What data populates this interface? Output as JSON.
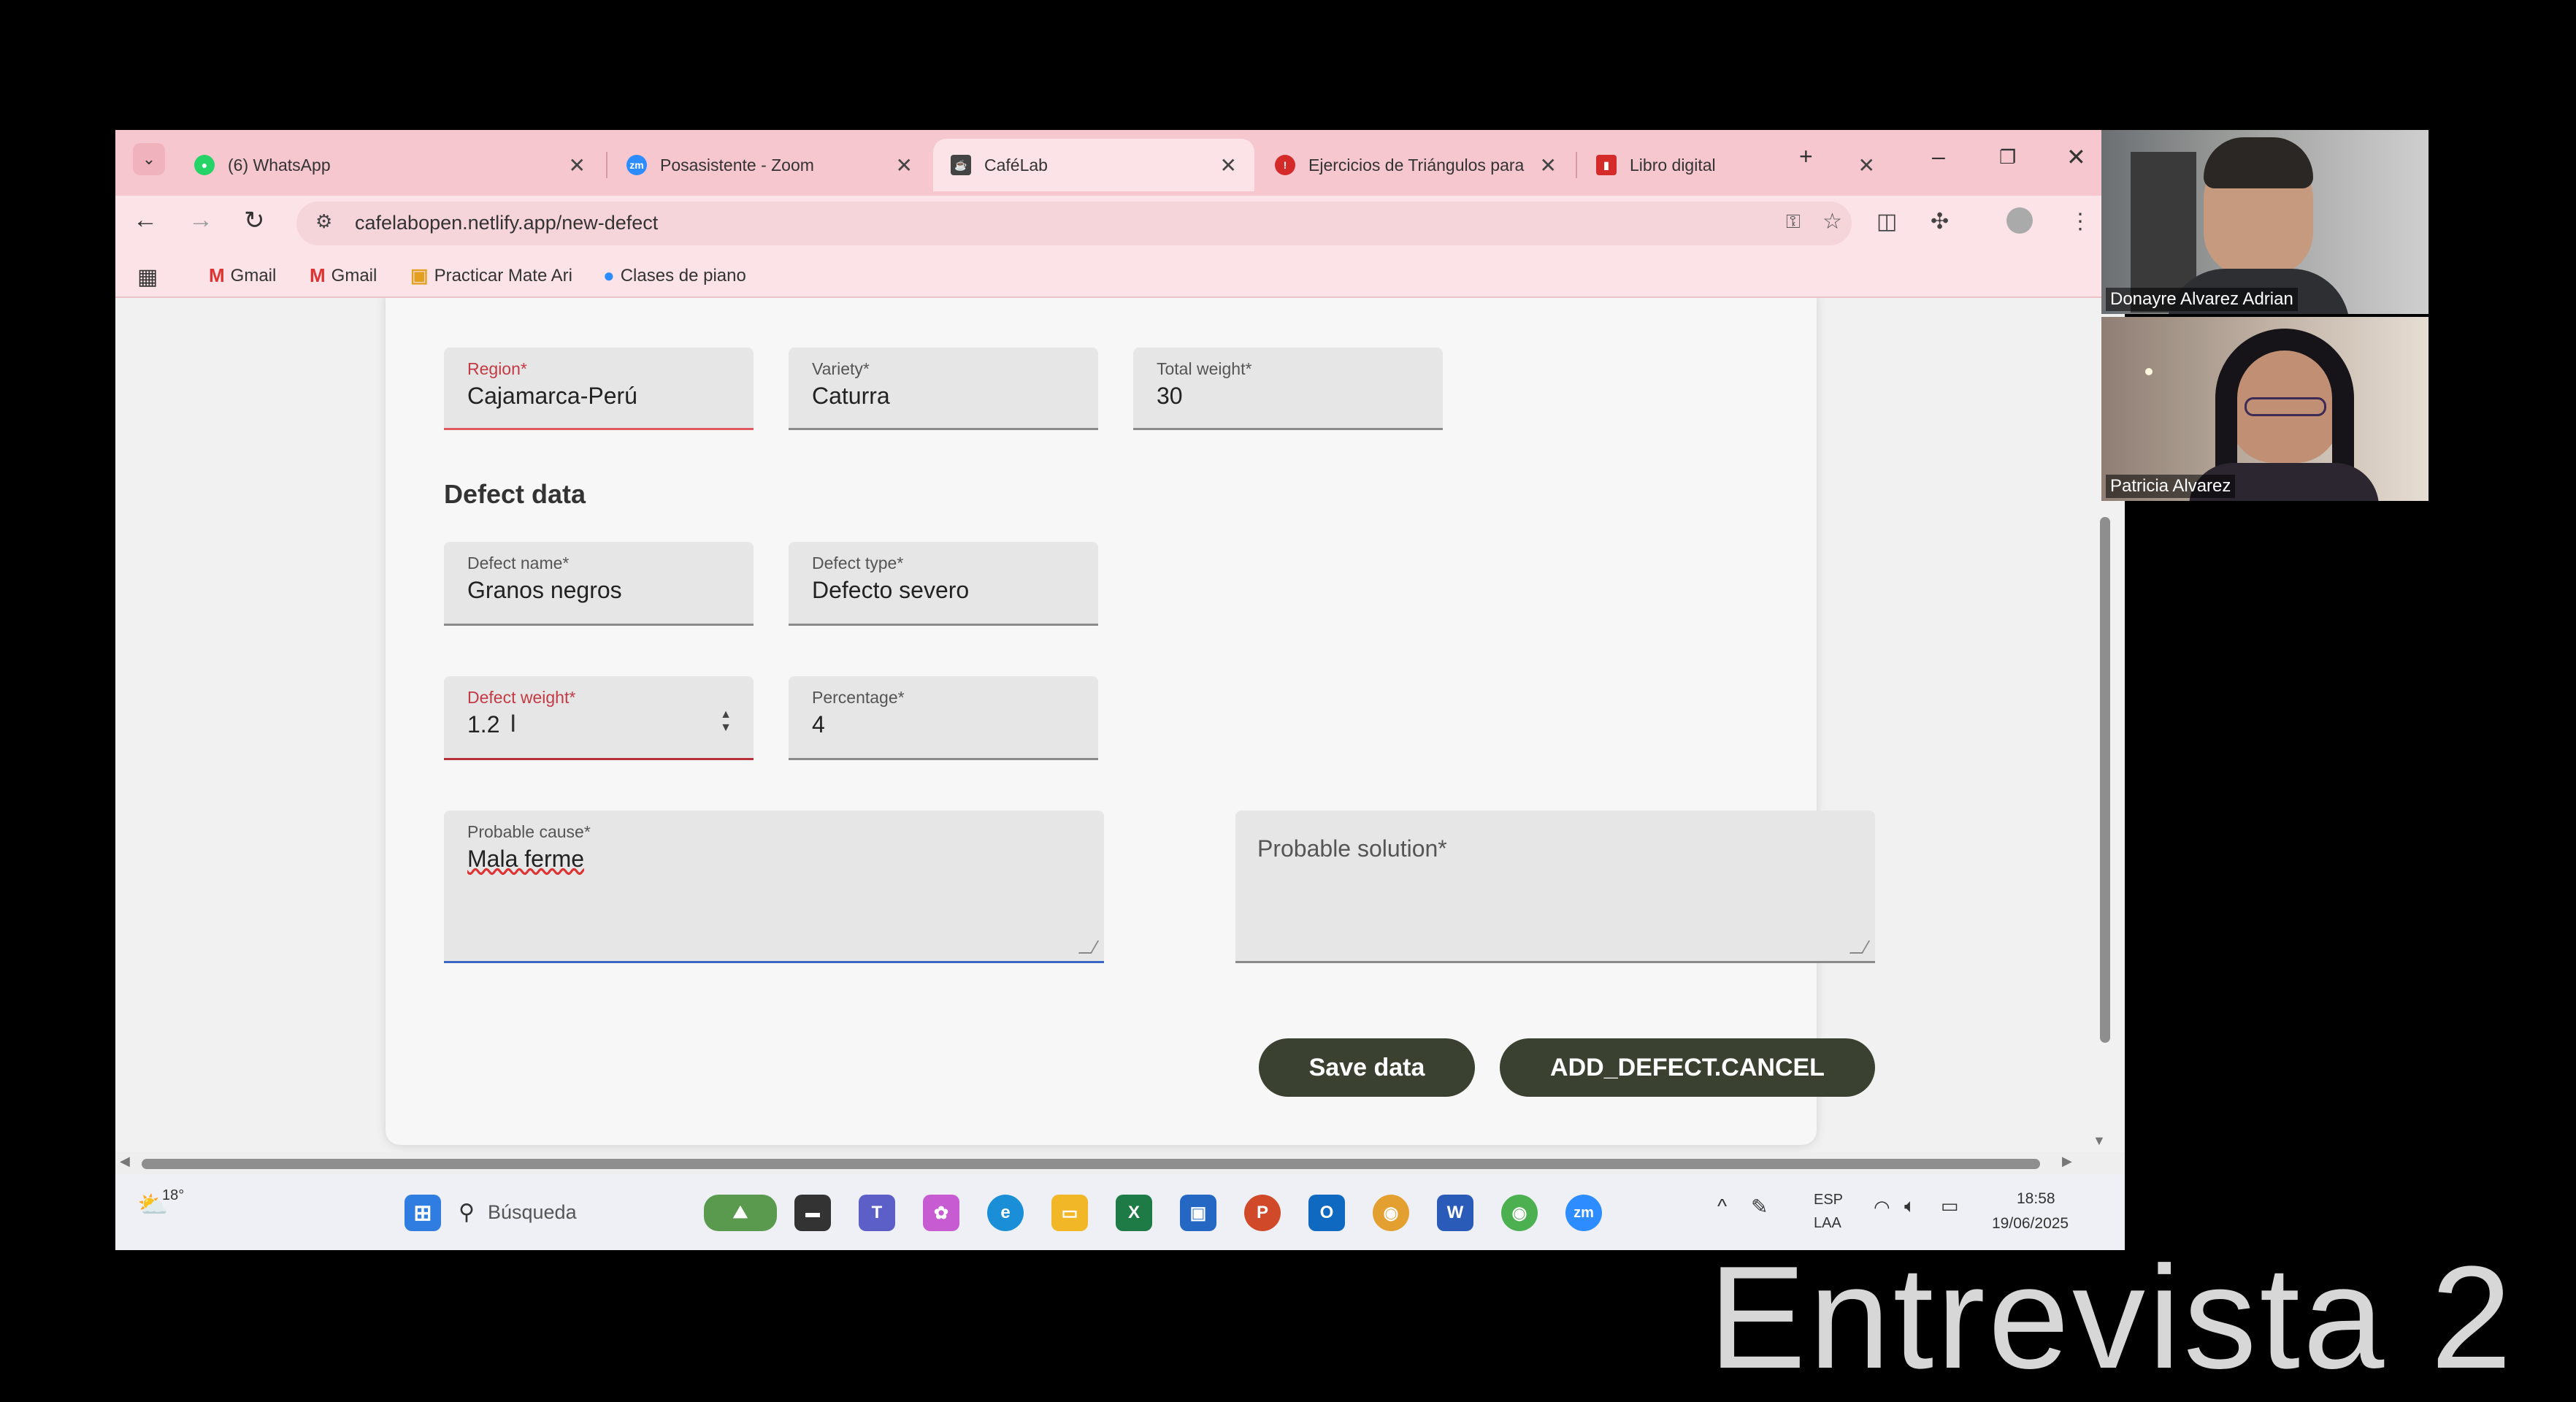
{
  "browser": {
    "tabs": [
      {
        "title": "(6) WhatsApp",
        "icon": "whatsapp-icon",
        "color": "#25d366"
      },
      {
        "title": "Posasistente - Zoom",
        "icon": "zoom-icon",
        "color": "#2d8cff"
      },
      {
        "title": "CaféLab",
        "icon": "cafelab-icon",
        "color": "#444444"
      },
      {
        "title": "Ejercicios de Triángulos para",
        "icon": "triangle-site-icon",
        "color": "#d42a2a"
      },
      {
        "title": "Libro digital",
        "icon": "book-icon",
        "color": "#d42a2a"
      }
    ],
    "active_tab": 2,
    "url": "cafelabopen.netlify.app/new-defect",
    "bookmarks": [
      "Gmail",
      "Gmail",
      "Practicar Mate Ari",
      "Clases de piano"
    ]
  },
  "form": {
    "region": {
      "label": "Region*",
      "value": "Cajamarca-Perú"
    },
    "variety": {
      "label": "Variety*",
      "value": "Caturra"
    },
    "total_weight": {
      "label": "Total weight*",
      "value": "30"
    },
    "defect_section_title": "Defect data",
    "defect_name": {
      "label": "Defect name*",
      "value": "Granos negros"
    },
    "defect_type": {
      "label": "Defect type*",
      "value": "Defecto severo"
    },
    "defect_weight": {
      "label": "Defect weight*",
      "value": "1.2"
    },
    "percentage": {
      "label": "Percentage*",
      "value": "4"
    },
    "probable_cause": {
      "label": "Probable cause*",
      "value": "Mala ferme"
    },
    "probable_solution": {
      "placeholder": "Probable solution*"
    },
    "save_button": "Save data",
    "cancel_button": "ADD_DEFECT.CANCEL"
  },
  "taskbar": {
    "weather": "18°",
    "search_placeholder": "Búsqueda",
    "lang_top": "ESP",
    "lang_bottom": "LAA",
    "time": "18:58",
    "date": "19/06/2025"
  },
  "participants": [
    "Donayre Alvarez Adrian",
    "Patricia Alvarez"
  ],
  "caption": "Entrevista 2",
  "colors": {
    "tab_bar": "#f6c7cf",
    "button": "#3b4131",
    "error": "#c33a44"
  }
}
